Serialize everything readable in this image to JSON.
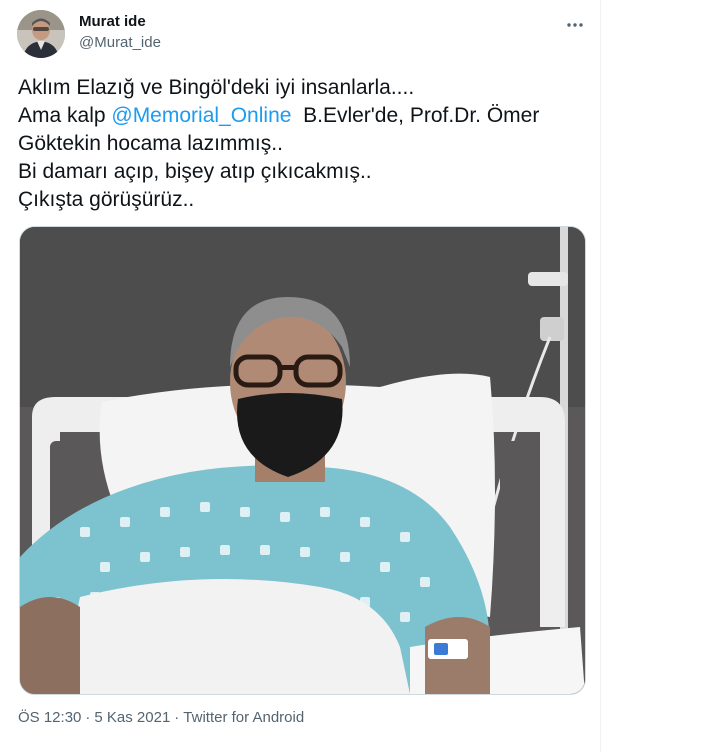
{
  "author": {
    "display_name": "Murat ide",
    "handle": "@Murat_ide"
  },
  "tweet": {
    "text_line1": "Aklım Elazığ ve Bingöl'deki iyi insanlarla....",
    "text_line2_prefix": "Ama kalp ",
    "mention": "@Memorial_Online",
    "text_line2_suffix": "  B.Evler'de, Prof.Dr. Ömer",
    "text_line3": "Göktekin hocama lazımmış..",
    "text_line4": "Bi damarı açıp, bişey atıp çıkıcakmış..",
    "text_line5": "Çıkışta görüşürüz.."
  },
  "meta": {
    "time": "ÖS 12:30",
    "separator": "·",
    "date": "5 Kas 2021",
    "source": "Twitter for Android"
  },
  "icons": {
    "more": "more-horizontal-icon"
  },
  "colors": {
    "accent": "#1d9bf0",
    "secondary_text": "#536471",
    "primary_text": "#0f1419"
  }
}
